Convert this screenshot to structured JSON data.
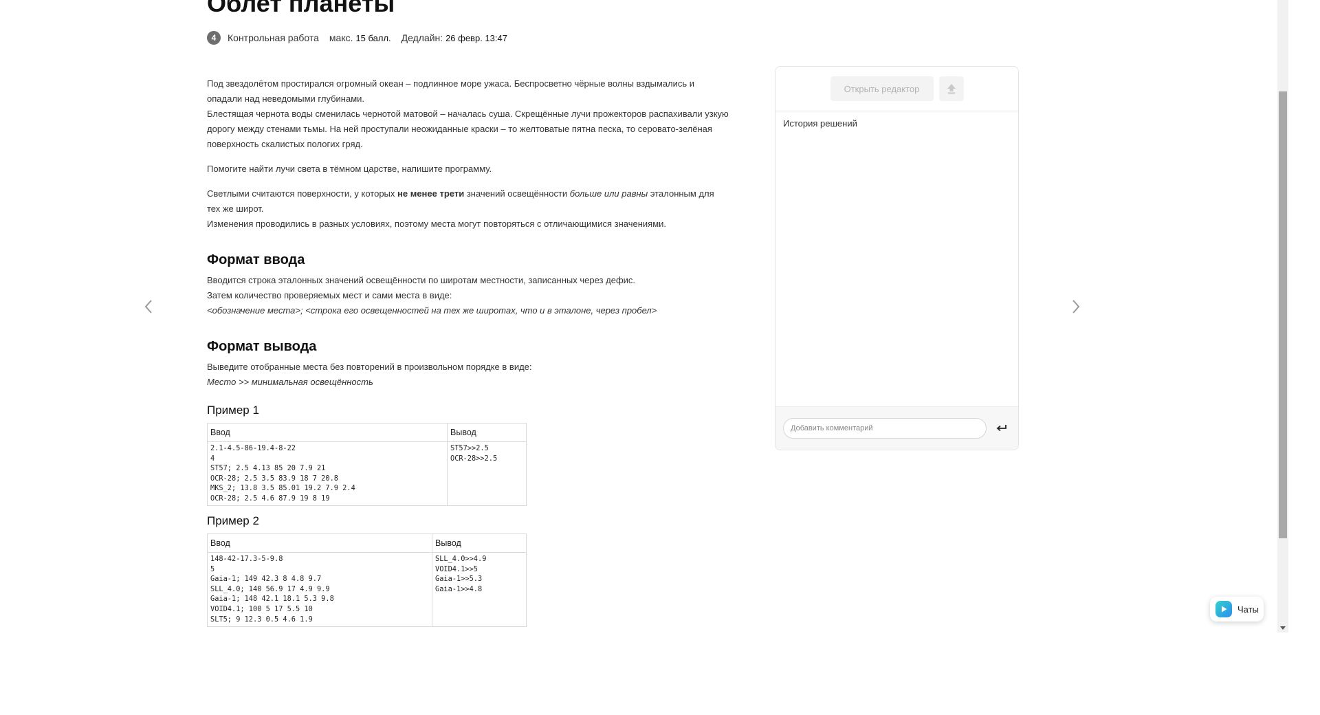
{
  "task": {
    "title": "Облет планеты",
    "badge_number": "4",
    "type": "Контрольная работа",
    "max_label": "макс.",
    "max_value": "15 балл.",
    "deadline_label": "Дедлайн:",
    "deadline_value": "26 февр. 13:47"
  },
  "statement": {
    "p1": "Под звездолётом простирался огромный океан – подлинное море ужаса. Беспросветно чёрные волны вздымались и опадали над неведомыми глубинами.",
    "p2": "Блестящая чернота воды сменилась чернотой матовой – началась суша. Скрещённые лучи прожекторов распахивали узкую дорогу между стенами тьмы. На ней проступали неожиданные краски – то желтоватые пятна песка, то серовато-зелёная поверхность скалистых пологих гряд.",
    "p3": "Помогите найти лучи света в тёмном царстве, напишите программу.",
    "p4_a": "Светлыми считаются поверхности, у которых ",
    "p4_b": "не менее трети",
    "p4_c": " значений освещённости ",
    "p4_d": "больше или равны",
    "p4_e": " эталонным для тех же широт.",
    "p5": "Изменения проводились в разных условиях, поэтому места могут повторяться с отличающимися значениями."
  },
  "input_format": {
    "heading": "Формат ввода",
    "line1": "Вводится строка эталонных значений освещённости по широтам местности, записанных через дефис.",
    "line2": "Затем количество проверяемых мест и сами места в виде:",
    "line3": "<обозначение места>; <строка его освещенностей на тех же широтах, что и в эталоне, через пробел>"
  },
  "output_format": {
    "heading": "Формат вывода",
    "line1": "Выведите отобранные места без повторений в произвольном порядке в виде:",
    "line2": "Место >> минимальная освещённость"
  },
  "examples": [
    {
      "title": "Пример 1",
      "col_in": "Ввод",
      "col_out": "Вывод",
      "input": "2.1-4.5-86-19.4-8-22\n4\nST57; 2.5 4.13 85 20 7.9 21\nOCR-28; 2.5 3.5 83.9 18 7 20.8\nMKS_2; 13.8 3.5 85.01 19.2 7.9 2.4\nOCR-28; 2.5 4.6 87.9 19 8 19",
      "output": "ST57>>2.5\nOCR-28>>2.5"
    },
    {
      "title": "Пример 2",
      "col_in": "Ввод",
      "col_out": "Вывод",
      "input": "148-42-17.3-5-9.8\n5\nGaia-1; 149 42.3 8 4.8 9.7\nSLL_4.0; 140 56.9 17 4.9 9.9\nGaia-1; 148 42.1 18.1 5.3 9.8\nVOID4.1; 100 5 17 5.5 10\nSLT5; 9 12.3 0.5 4.6 1.9",
      "output": "SLL_4.0>>4.9\nVOID4.1>>5\nGaia-1>>5.3\nGaia-1>>4.8"
    }
  ],
  "panel": {
    "open_editor": "Открыть редактор",
    "history_title": "История решений",
    "comment_placeholder": "Добавить комментарий"
  },
  "nav": {
    "prev_icon": "chevron-left-icon",
    "next_icon": "chevron-right-icon"
  },
  "chats": {
    "label": "Чаты"
  },
  "colors": {
    "badge": "#6e6e6e",
    "disabled_button": "#f3f3f3",
    "disabled_text": "#b3b3b3",
    "chats_accent": "#2fd3c9"
  }
}
